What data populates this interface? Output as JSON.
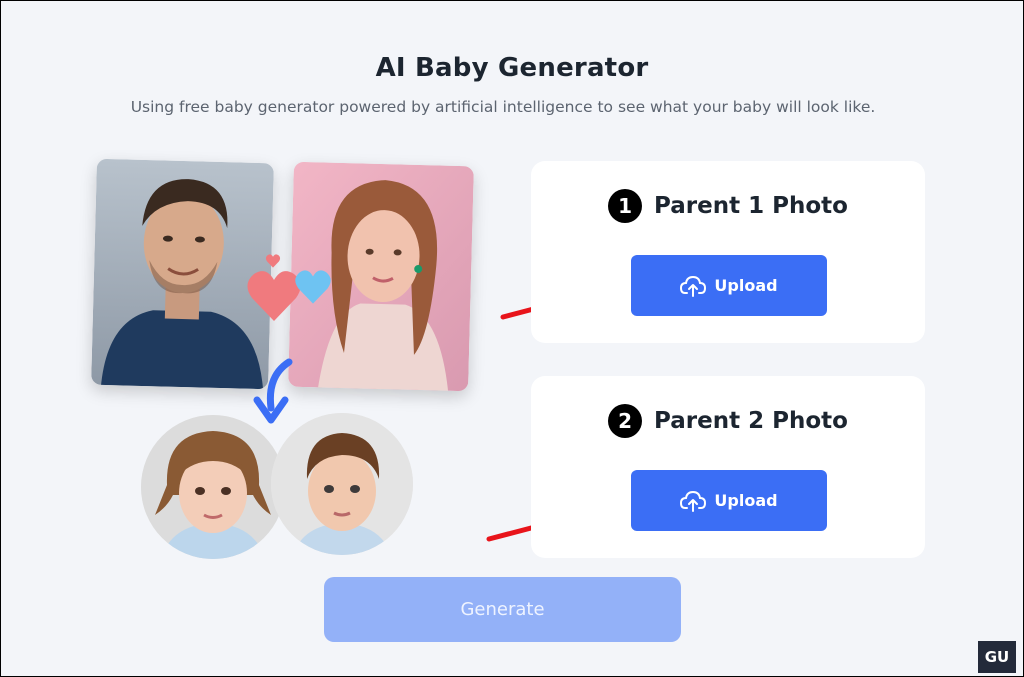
{
  "header": {
    "title": "AI Baby Generator",
    "subtitle": "Using free baby generator powered by artificial intelligence to see what your baby will look like."
  },
  "parent1": {
    "number": "1",
    "title": "Parent 1 Photo",
    "button_label": "Upload"
  },
  "parent2": {
    "number": "2",
    "title": "Parent 2 Photo",
    "button_label": "Upload"
  },
  "generate_label": "Generate",
  "watermark": "GU",
  "colors": {
    "accent": "#3b6ef5",
    "accent_disabled": "#93b1f8",
    "annotation_arrow": "#e8141b",
    "background": "#f3f5f9",
    "card": "#ffffff"
  },
  "icons": {
    "upload": "cloud-upload-icon",
    "heart": "heart-icon",
    "curved_arrow": "curved-arrow-down-icon"
  }
}
